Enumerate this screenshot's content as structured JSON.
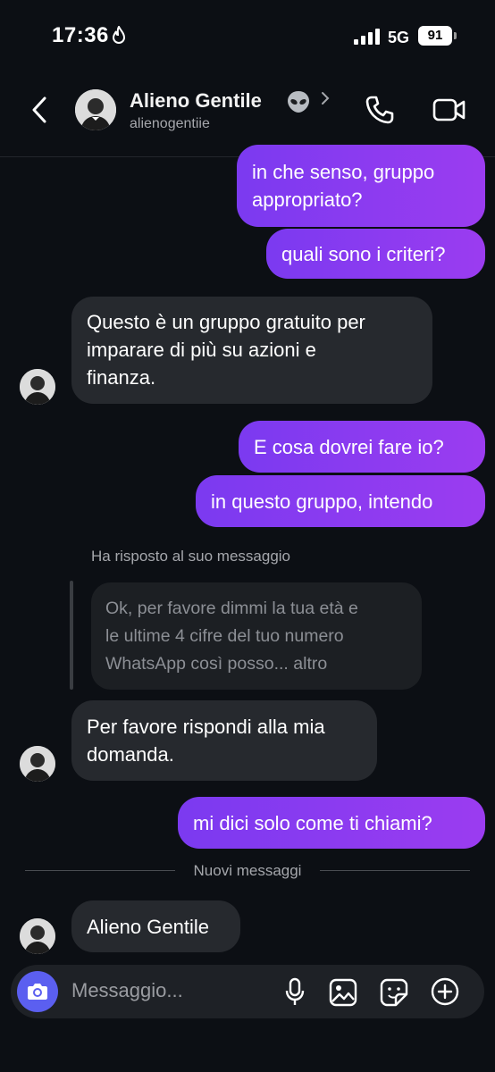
{
  "status_bar": {
    "time": "17:36",
    "network": "5G",
    "battery": "91"
  },
  "header": {
    "title": "Alieno Gentile",
    "emoji": "👽",
    "username": "alienogentiie"
  },
  "messages": [
    {
      "dir": "out",
      "lines": [
        "in che senso, gruppo",
        "appropriato?"
      ]
    },
    {
      "dir": "out",
      "lines": [
        "quali sono i criteri?"
      ]
    },
    {
      "dir": "in",
      "lines": [
        "Questo è un gruppo gratuito per",
        "imparare di più su azioni e",
        "finanza."
      ]
    },
    {
      "dir": "out",
      "lines": [
        "E cosa dovrei fare io?"
      ]
    },
    {
      "dir": "out",
      "lines": [
        "in questo gruppo, intendo"
      ]
    },
    {
      "dir": "in",
      "lines": [
        "Per favore rispondi alla mia",
        "domanda."
      ]
    },
    {
      "dir": "out",
      "lines": [
        "mi dici solo come ti chiami?"
      ]
    },
    {
      "dir": "in",
      "lines": [
        "Alieno Gentile"
      ]
    }
  ],
  "reply": {
    "label": "Ha risposto al suo messaggio",
    "quoted_lines": [
      "Ok, per favore dimmi la tua età e",
      "le ultime 4 cifre del tuo numero",
      "WhatsApp così posso... altro"
    ]
  },
  "divider_label": "Nuovi messaggi",
  "composer": {
    "placeholder": "Messaggio..."
  }
}
